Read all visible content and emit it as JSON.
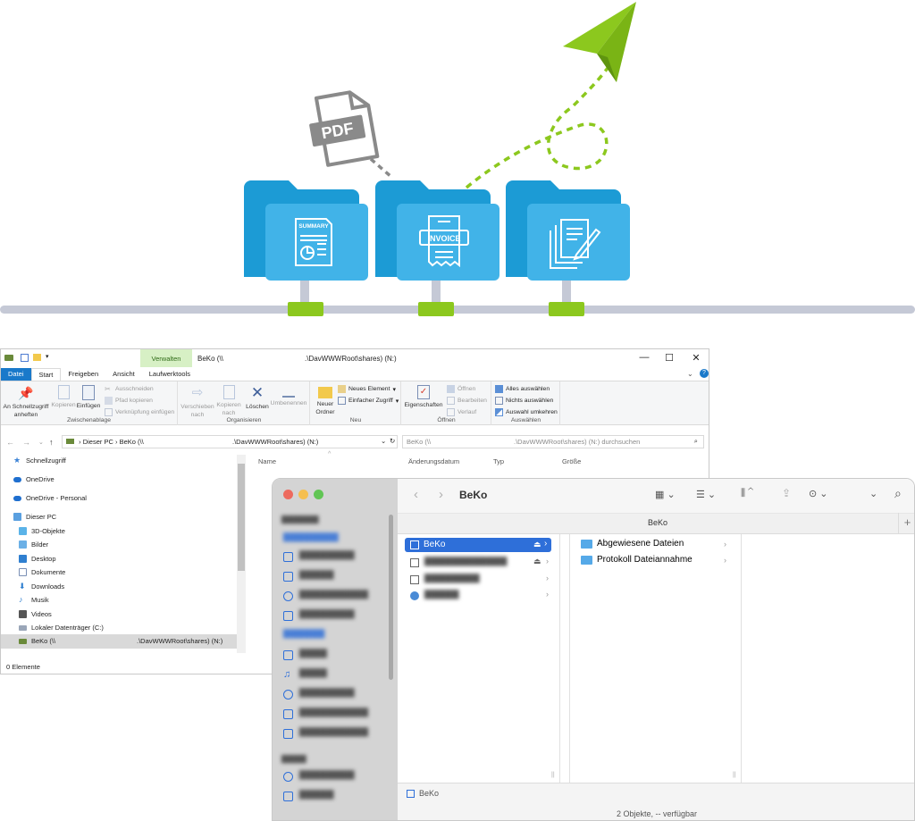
{
  "illustration": {
    "pdf_badge": "PDF",
    "folders": [
      {
        "name": "summary-folder",
        "label": "SUMMARY"
      },
      {
        "name": "invoice-folder",
        "label": "INVOICE"
      },
      {
        "name": "documents-folder",
        "label": ""
      }
    ],
    "colors": {
      "folder_back": "#1c9bd5",
      "folder_front": "#41b3e8",
      "connector": "#8cc81e",
      "rail": "#c5c9d6",
      "plane": "#8cc81e"
    }
  },
  "explorer": {
    "context_tab": "Verwalten",
    "title": "BeKo (\\\\",
    "title_path": ".\\DavWWWRoot\\shares) (N:)",
    "controls": {
      "minimize": "—",
      "maximize": "☐",
      "close": "✕"
    },
    "tabs": [
      "Datei",
      "Start",
      "Freigeben",
      "Ansicht",
      "Laufwerktools"
    ],
    "groups": {
      "clipboard": {
        "label": "Zwischenablage",
        "pin": "An Schnellzugriff anheften",
        "copy": "Kopieren",
        "paste": "Einfügen",
        "cut": "Ausschneiden",
        "copy_path": "Pfad kopieren",
        "paste_link": "Verknüpfung einfügen"
      },
      "organize": {
        "label": "Organisieren",
        "move": "Verschieben nach",
        "copyto": "Kopieren nach",
        "delete": "Löschen",
        "rename": "Umbenennen"
      },
      "new": {
        "label": "Neu",
        "new_folder": "Neuer Ordner",
        "new_item": "Neues Element",
        "easy_access": "Einfacher Zugriff"
      },
      "open": {
        "label": "Öffnen",
        "properties": "Eigenschaften",
        "open": "Öffnen",
        "edit": "Bearbeiten",
        "history": "Verlauf"
      },
      "select": {
        "label": "Auswählen",
        "all": "Alles auswählen",
        "none": "Nichts auswählen",
        "invert": "Auswahl umkehren"
      }
    },
    "address": {
      "crumbs": [
        "Dieser PC",
        "BeKo (\\\\"
      ],
      "crumb_path": ".\\DavWWWRoot\\shares) (N:)",
      "search_placeholder": "BeKo (\\\\",
      "search_tail": ".\\DavWWWRoot\\shares) (N:) durchsuchen"
    },
    "sidebar": [
      {
        "label": "Schnellzugriff",
        "icon": "star-icon"
      },
      {
        "label": "OneDrive",
        "icon": "cloud-icon"
      },
      {
        "label": "OneDrive - Personal",
        "icon": "cloud-icon"
      },
      {
        "label": "Dieser PC",
        "icon": "computer-icon"
      },
      {
        "label": "3D-Objekte",
        "icon": "cube-icon"
      },
      {
        "label": "Bilder",
        "icon": "image-icon"
      },
      {
        "label": "Desktop",
        "icon": "desktop-icon"
      },
      {
        "label": "Dokumente",
        "icon": "document-icon"
      },
      {
        "label": "Downloads",
        "icon": "download-icon"
      },
      {
        "label": "Musik",
        "icon": "music-icon"
      },
      {
        "label": "Videos",
        "icon": "video-icon"
      },
      {
        "label": "Lokaler Datenträger (C:)",
        "icon": "drive-icon"
      },
      {
        "label": "BeKo (\\\\",
        "icon": "network-drive-icon"
      }
    ],
    "sidebar_selected_path": ".\\DavWWWRoot\\shares) (N:)",
    "columns": [
      "Name",
      "Änderungsdatum",
      "Typ",
      "Größe"
    ],
    "status": "0 Elemente"
  },
  "finder": {
    "title": "BeKo",
    "path_title": "BeKo",
    "locations": [
      {
        "label": "BeKo",
        "selected": true
      },
      {
        "label": "",
        "selected": false
      },
      {
        "label": "",
        "selected": false
      },
      {
        "label": "",
        "selected": false
      }
    ],
    "folders": [
      "Abgewiesene Dateien",
      "Protokoll Dateiannahme"
    ],
    "path_footer": "BeKo",
    "status": "2 Objekte, -- verfügbar"
  }
}
